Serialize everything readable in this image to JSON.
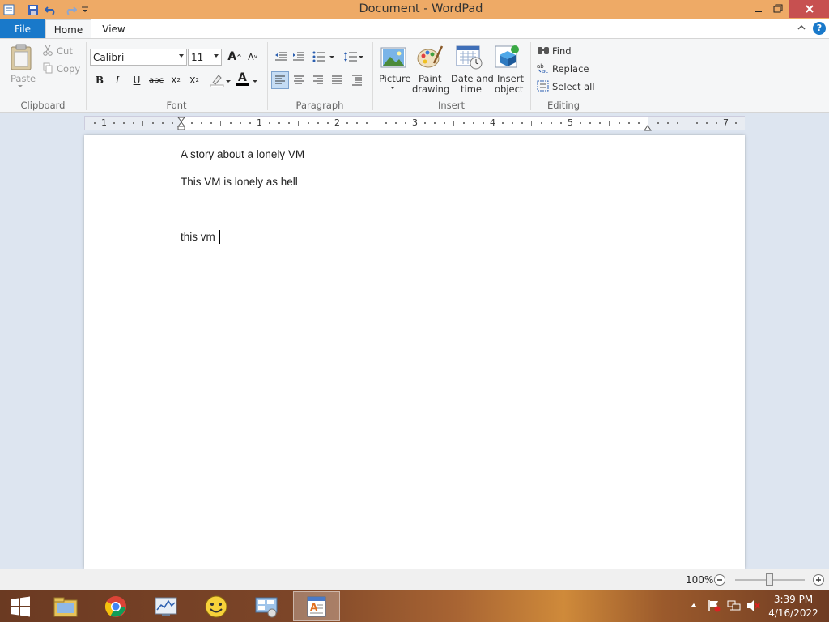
{
  "window": {
    "title": "Document - WordPad"
  },
  "tabs": {
    "file": "File",
    "home": "Home",
    "view": "View"
  },
  "clipboard": {
    "paste": "Paste",
    "cut": "Cut",
    "copy": "Copy",
    "group": "Clipboard"
  },
  "font": {
    "family": "Calibri",
    "size": "11",
    "group": "Font"
  },
  "paragraph": {
    "group": "Paragraph"
  },
  "insert": {
    "picture": "Picture",
    "paint_line1": "Paint",
    "paint_line2": "drawing",
    "datetime_line1": "Date and",
    "datetime_line2": "time",
    "object_line1": "Insert",
    "object_line2": "object",
    "group": "Insert"
  },
  "editing": {
    "find": "Find",
    "replace": "Replace",
    "select_all": "Select all",
    "group": "Editing"
  },
  "ruler": {
    "numbers": [
      "1",
      "1",
      "2",
      "3",
      "4",
      "5",
      "7"
    ]
  },
  "document": {
    "paragraphs": [
      "A story about a lonely VM",
      "This VM is lonely as hell",
      "",
      "this vm "
    ]
  },
  "status": {
    "zoom": "100%"
  },
  "tray": {
    "time": "3:39 PM",
    "date": "4/16/2022"
  },
  "colors": {
    "file_tab": "#1979ca",
    "titlebar": "#eeaa66",
    "doc_bg": "#dde5f0"
  }
}
